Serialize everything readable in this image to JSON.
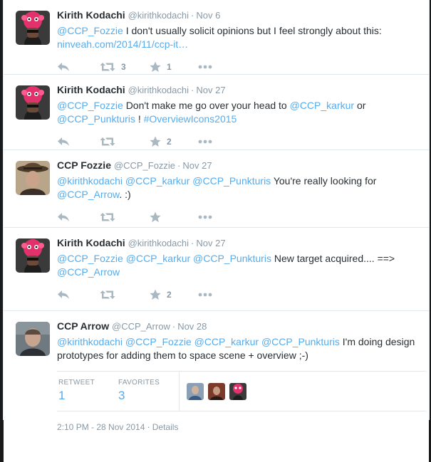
{
  "tweets": [
    {
      "name": "Kirith Kodachi",
      "handle": "@kirithkodachi",
      "time": "Nov 6",
      "line1": "I don't usually solicit opinions but I feel strongly about this:",
      "mention1": "@CCP_Fozzie",
      "url": "ninveah.com/2014/11/ccp-it…",
      "retweets": "3",
      "favorites": "1"
    },
    {
      "name": "Kirith Kodachi",
      "handle": "@kirithkodachi",
      "time": "Nov 27",
      "mention1": "@CCP_Fozzie",
      "text1": "Don't make me go over your head to",
      "mention2": "@CCP_karkur",
      "text2": "or",
      "mention3": "@CCP_Punkturis",
      "text3": "!",
      "hashtag": "#OverviewIcons2015",
      "favorites": "2"
    },
    {
      "name": "CCP Fozzie",
      "handle": "@CCP_Fozzie",
      "time": "Nov 27",
      "mention1": "@kirithkodachi",
      "mention2": "@CCP_karkur",
      "mention3": "@CCP_Punkturis",
      "text1": "You're really looking for",
      "mention4": "@CCP_Arrow",
      "text2": ". :)"
    },
    {
      "name": "Kirith Kodachi",
      "handle": "@kirithkodachi",
      "time": "Nov 27",
      "mention1": "@CCP_Fozzie",
      "mention2": "@CCP_karkur",
      "mention3": "@CCP_Punkturis",
      "text1": "New target acquired.... ==>",
      "mention4": "@CCP_Arrow",
      "favorites": "2"
    },
    {
      "name": "CCP Arrow",
      "handle": "@CCP_Arrow",
      "time": "Nov 28",
      "mention1": "@kirithkodachi",
      "mention2": "@CCP_Fozzie",
      "mention3": "@CCP_karkur",
      "mention4": "@CCP_Punkturis",
      "text1": "I'm doing design prototypes for adding them to space scene + overview ;-)",
      "retweet_label": "RETWEET",
      "retweet_count": "1",
      "favorites_label": "FAVORITES",
      "favorites_count": "3",
      "timestamp": "2:10 PM - 28 Nov 2014",
      "details": "Details"
    }
  ],
  "colors": {
    "link": "#55acee",
    "muted": "#8899a6",
    "text": "#292f33",
    "divider": "#e1e8ed"
  },
  "icons": [
    "reply-icon",
    "retweet-icon",
    "favorite-star-icon",
    "more-dots-icon"
  ]
}
